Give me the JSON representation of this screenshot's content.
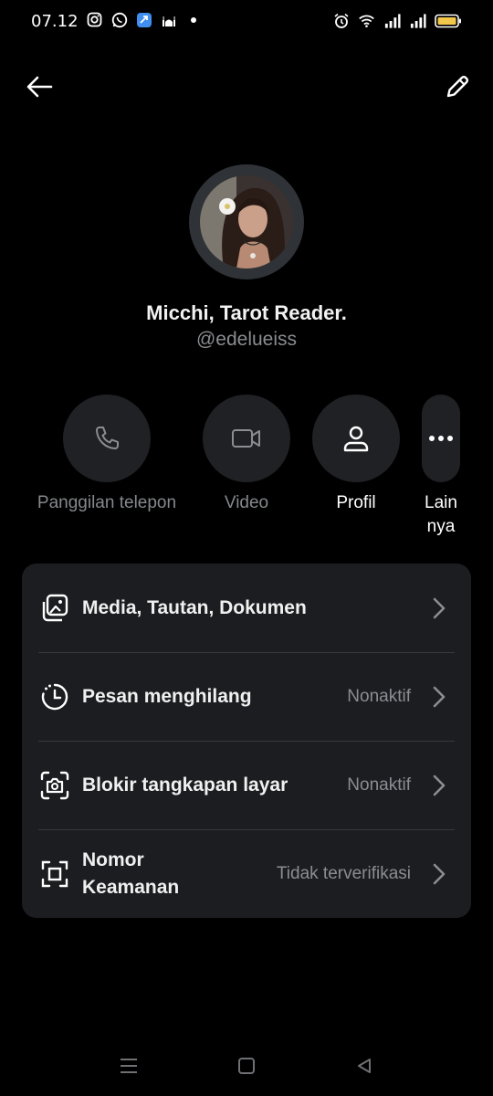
{
  "status_bar": {
    "time": "07.12",
    "left_icons": [
      "instagram-icon",
      "whatsapp-icon",
      "app-icon",
      "mosque-icon",
      "dot-icon"
    ],
    "right_icons": [
      "alarm-icon",
      "wifi-icon",
      "signal-icon",
      "signal-icon",
      "battery-icon"
    ],
    "battery_color": "#f3c84a"
  },
  "header": {
    "back_icon": "arrow-left-icon",
    "edit_icon": "pencil-icon"
  },
  "profile": {
    "name": "Micchi, Tarot Reader.",
    "handle": "@edelueiss"
  },
  "actions": [
    {
      "label": "Panggilan telepon",
      "icon": "phone-icon",
      "enabled": false
    },
    {
      "label": "Video",
      "icon": "video-camera-icon",
      "enabled": false
    },
    {
      "label": "Profil",
      "icon": "person-icon",
      "enabled": true
    },
    {
      "label": "Lain\nnya",
      "icon": "more-dots-icon",
      "enabled": true
    }
  ],
  "settings": [
    {
      "label": "Media, Tautan, Dokumen",
      "value": "",
      "icon": "media-gallery-icon"
    },
    {
      "label": "Pesan menghilang",
      "value": "Nonaktif",
      "icon": "timer-icon"
    },
    {
      "label": "Blokir tangkapan layar",
      "value": "Nonaktif",
      "icon": "screenshot-camera-icon"
    },
    {
      "label": "Nomor\nKeamanan",
      "value": "Tidak terverifikasi",
      "icon": "security-frame-icon"
    }
  ],
  "colors": {
    "background": "#000000",
    "card": "#1c1d20",
    "circle": "#202124",
    "muted_text": "#8a8d91"
  }
}
